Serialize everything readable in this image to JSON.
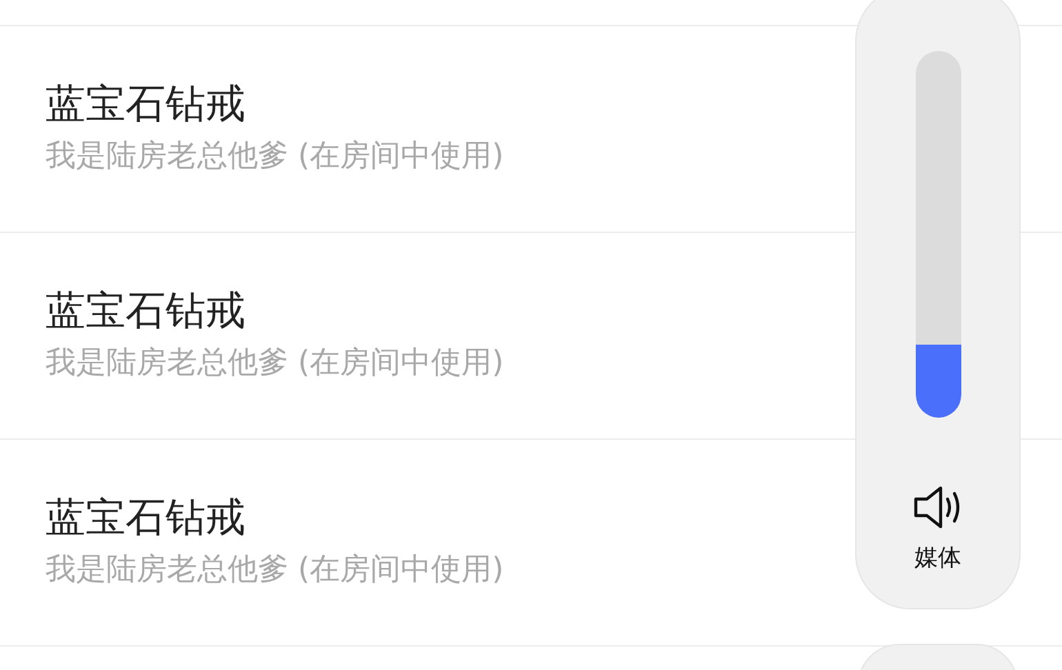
{
  "items": [
    {
      "title": "蓝宝石钻戒",
      "subtitle": "我是陆房老总他爹 (在房间中使用)"
    },
    {
      "title": "蓝宝石钻戒",
      "subtitle": "我是陆房老总他爹 (在房间中使用)"
    },
    {
      "title": "蓝宝石钻戒",
      "subtitle": "我是陆房老总他爹 (在房间中使用)"
    }
  ],
  "volume_panel": {
    "level": 0.2,
    "label": "媒体"
  }
}
